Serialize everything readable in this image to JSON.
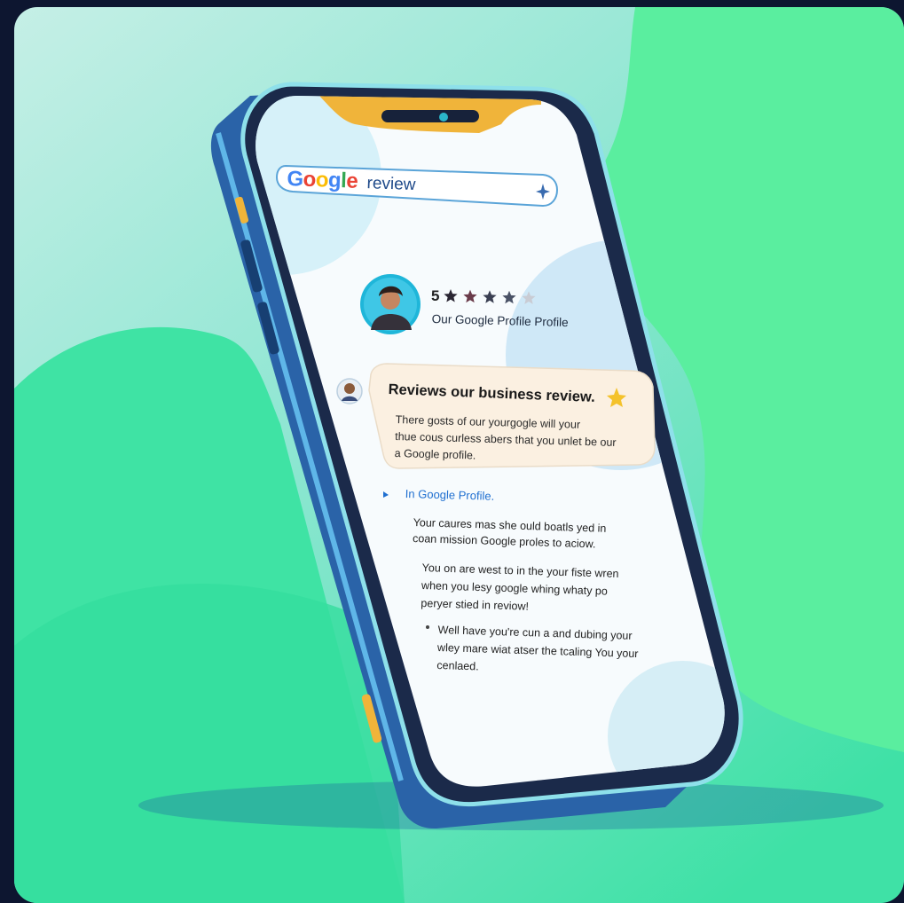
{
  "search": {
    "brand_letters": [
      {
        "char": "G",
        "color": "#4285f4"
      },
      {
        "char": "o",
        "color": "#ea4335"
      },
      {
        "char": "o",
        "color": "#fbbc05"
      },
      {
        "char": "g",
        "color": "#4285f4"
      },
      {
        "char": "l",
        "color": "#34a853"
      },
      {
        "char": "e",
        "color": "#ea4335"
      }
    ],
    "query_suffix": "review",
    "sparkle_icon": "sparkle-icon"
  },
  "profile": {
    "rating_text": "5",
    "stars": 5,
    "name": "Our Google Profile Profile",
    "avatar_icon": "person-avatar"
  },
  "review_card": {
    "title": "Reviews our business review.",
    "title_star_icon": "star-icon",
    "body_lines": [
      "There gosts of our yourgogle will your",
      "thue cous curless abers that you unlet be our",
      "a Google profile."
    ]
  },
  "section_heading": "In Google Profile.",
  "paragraphs": [
    [
      "Your caures mas she ould boatls yed in",
      "coan mission Google proles to aciow."
    ],
    [
      "You on are west to in the your fiste wren",
      "when you lesy google whing whaty po",
      "peryer stied in reviow!"
    ],
    [
      "Well have you're cun a and dubing your",
      "wley mare wiat atser the tcaling You your",
      "cenlaed."
    ]
  ],
  "colors": {
    "bg_green": "#38df9f",
    "bg_mint": "#a6e8dc",
    "phone_blue": "#2a63a8",
    "accent_yellow": "#f0b43a",
    "card_cream": "#fbf0e1",
    "link_blue": "#1f6fd0"
  }
}
